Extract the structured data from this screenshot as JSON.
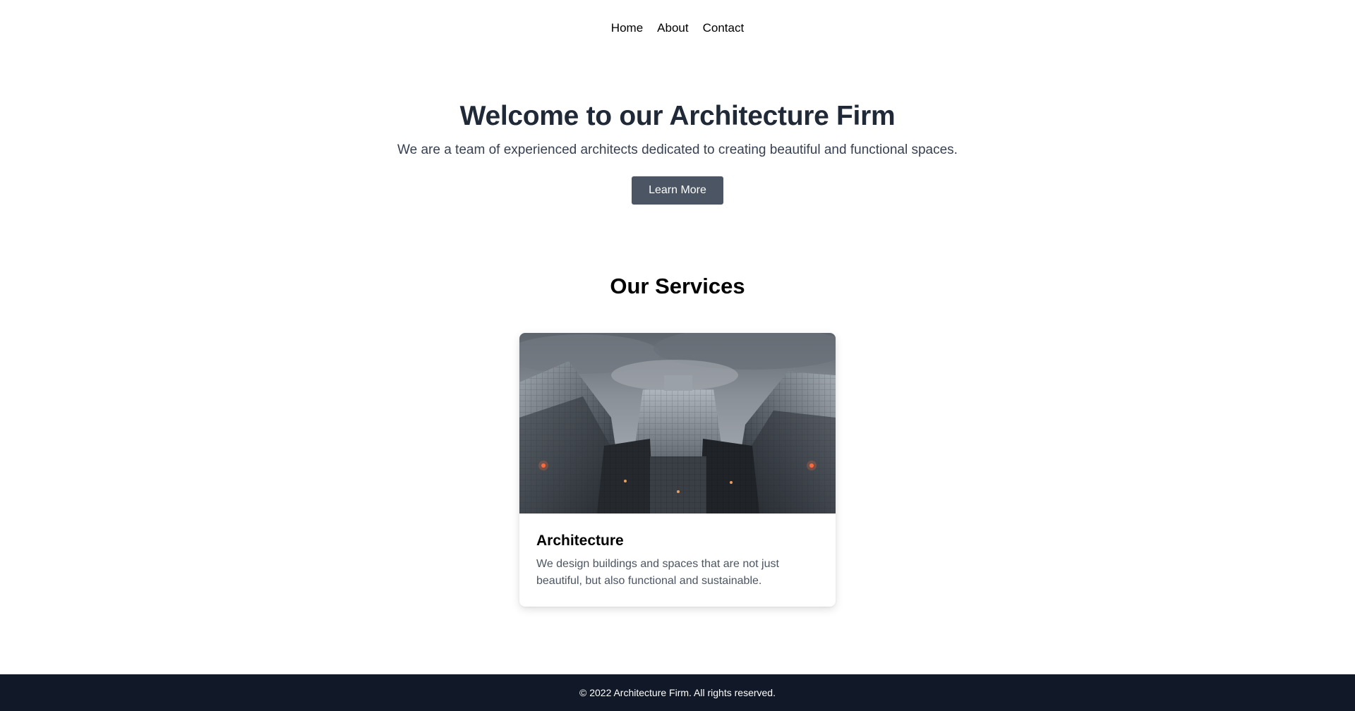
{
  "nav": {
    "items": [
      {
        "label": "Home"
      },
      {
        "label": "About"
      },
      {
        "label": "Contact"
      }
    ]
  },
  "hero": {
    "title": "Welcome to our Architecture Firm",
    "subtitle": "We are a team of experienced architects dedicated to creating beautiful and functional spaces.",
    "button_label": "Learn More"
  },
  "services": {
    "title": "Our Services",
    "cards": [
      {
        "title": "Architecture",
        "description": "We design buildings and spaces that are not just beautiful, but also functional and sustainable.",
        "image": "skyscrapers-looking-up-photo"
      }
    ]
  },
  "footer": {
    "text": "© 2022 Architecture Firm. All rights reserved."
  },
  "colors": {
    "button_bg": "#4b5563",
    "footer_bg": "#111827",
    "heading": "#1f2937"
  }
}
